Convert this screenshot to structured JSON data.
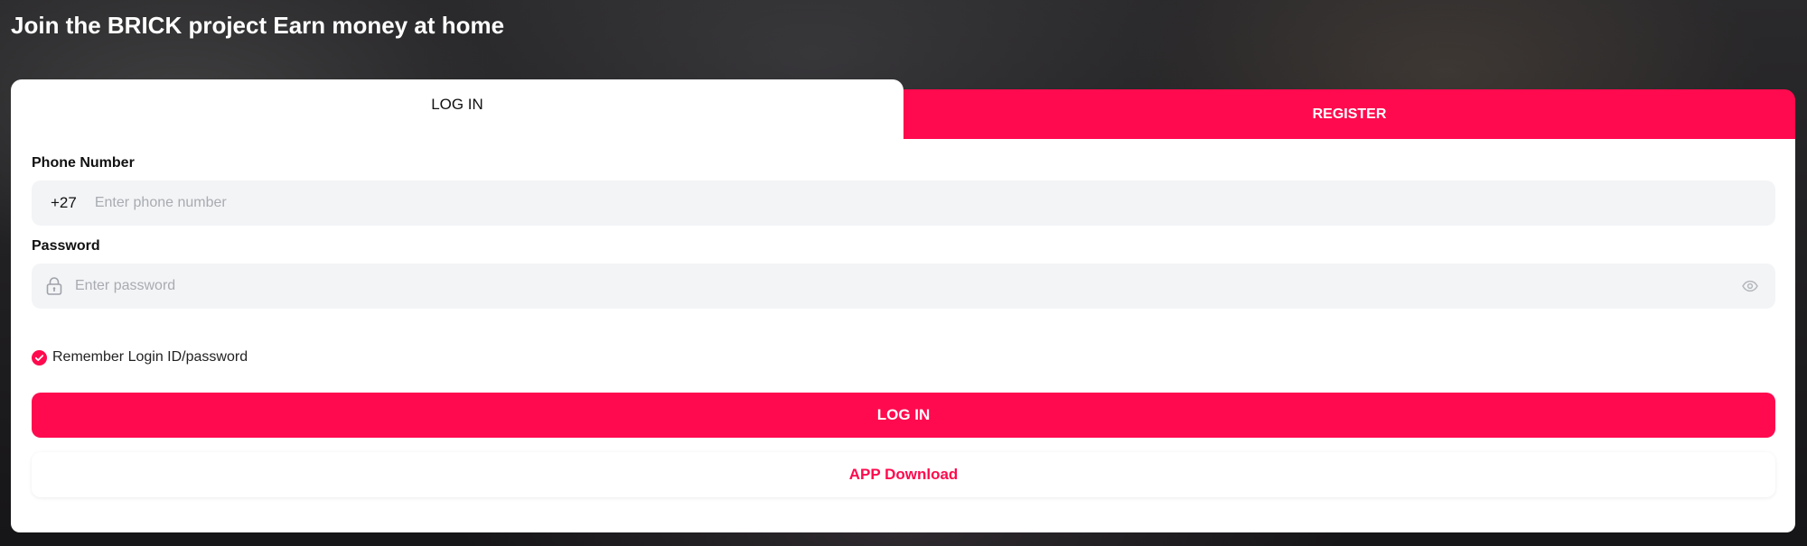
{
  "headline": "Join the BRICK project Earn money at home",
  "tabs": {
    "login": "LOG IN",
    "register": "REGISTER"
  },
  "phone": {
    "label": "Phone Number",
    "country_code": "+27",
    "placeholder": "Enter phone number",
    "value": ""
  },
  "password": {
    "label": "Password",
    "placeholder": "Enter password",
    "value": ""
  },
  "remember": {
    "label": "Remember Login ID/password",
    "checked": true
  },
  "buttons": {
    "login": "LOG IN",
    "app_download": "APP Download"
  },
  "icons": {
    "lock": "lock-icon",
    "eye": "eye-icon",
    "check": "check-circle-icon"
  },
  "colors": {
    "accent": "#ff0a4e",
    "field_bg": "#f3f4f6",
    "text": "#111111",
    "placeholder": "#a8abb0"
  }
}
